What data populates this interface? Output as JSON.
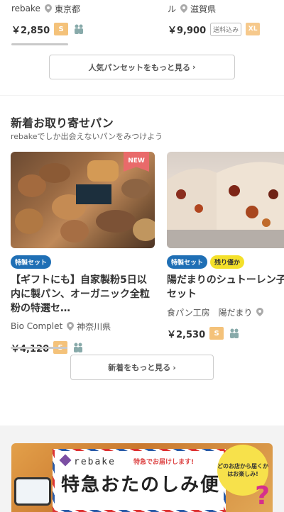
{
  "top_cards": [
    {
      "shop": "rebake",
      "location": "東京都",
      "price": "￥2,850",
      "size": "S"
    },
    {
      "shop": "ル",
      "location": "滋賀県",
      "price": "￥9,900",
      "tax_note": "送料込み",
      "size": "XL"
    }
  ],
  "popular_more_label": "人気パンセットをもっと見る",
  "new_section": {
    "title": "新着お取り寄せパン",
    "subtitle": "rebakeでしか出会えないパンをみつけよう",
    "cards": [
      {
        "new_badge": "NEW",
        "tags": [
          "特製セット"
        ],
        "title": "【ギフトにも】自家製粉5日以内に製パン、オーガニック全粒粉の特選セ…",
        "shop": "Bio Complet",
        "location": "神奈川県",
        "price": "￥4,120",
        "size": "S"
      },
      {
        "tags": [
          "特製セット",
          "残り僅か"
        ],
        "title": "陽だまりのシュトーレン子セット",
        "shop": "食パン工房　陽だまり",
        "location": "",
        "price": "￥2,530",
        "size": "S"
      }
    ],
    "more_label": "新着をもっと見る"
  },
  "banner": {
    "logo": "rebake",
    "sub": "特急でお届けします!",
    "title": "特急おたのしみ便",
    "bubble": "どのお店から届くかはお楽しみ!",
    "mark": "?"
  },
  "colors": {
    "tag_blue": "#1f6fb5",
    "tag_yellow": "#f4e02a",
    "new_badge": "#e96a6a",
    "size_badge": "#f4c27a"
  }
}
